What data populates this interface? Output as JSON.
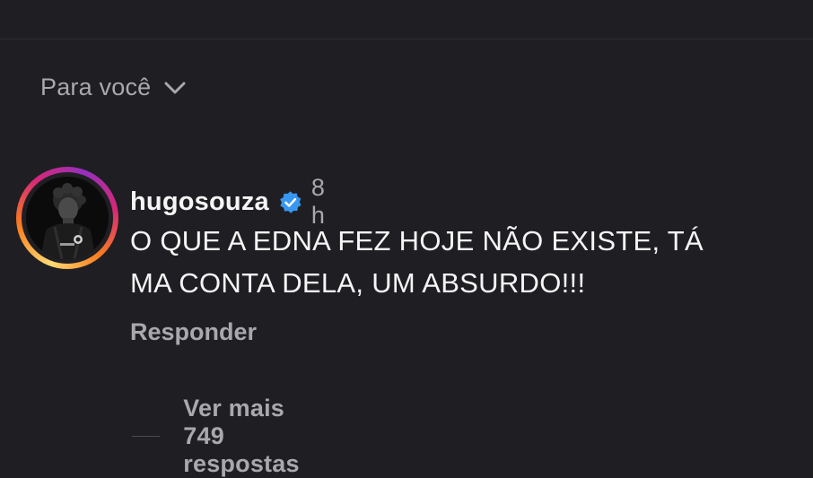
{
  "sort": {
    "label": "Para você",
    "icon": "chevron-down-icon"
  },
  "comment": {
    "username": "hugosouza",
    "verified_icon": "verified-badge-icon",
    "timestamp": "8 h",
    "text_lines": [
      "O QUE A EDNA FEZ HOJE NÃO EXISTE, TÁ",
      "MA CONTA DELA, UM ABSURDO!!!"
    ],
    "reply_label": "Responder",
    "more_replies_label": "Ver mais 749 respostas"
  },
  "colors": {
    "background": "#1f1f23",
    "primary_text": "#f5f5f5",
    "secondary_text": "#a8a8ad",
    "verified_blue": "#3897f0"
  }
}
